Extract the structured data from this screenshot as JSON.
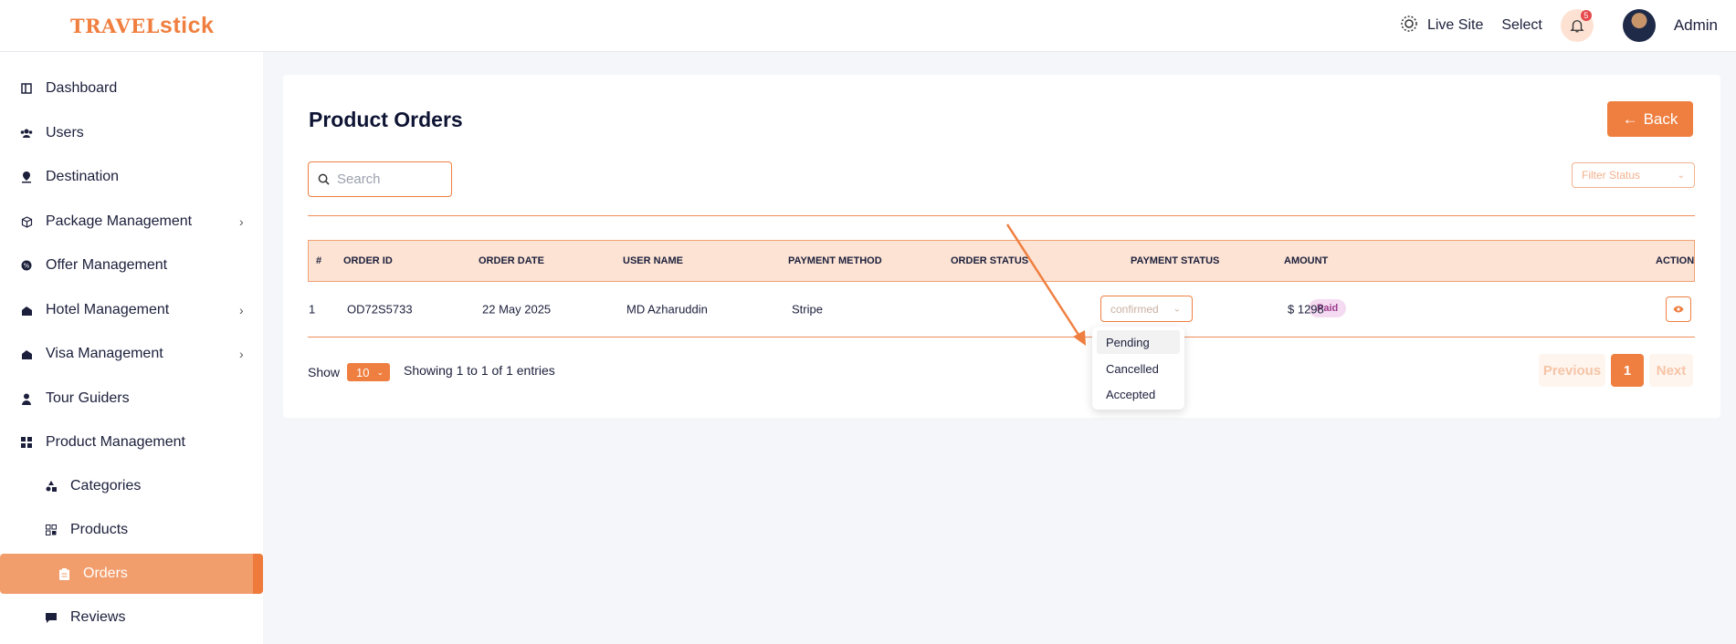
{
  "header": {
    "logo_prefix": "TRAVEL",
    "logo_suffix": "stick",
    "live_site_label": "Live Site",
    "select_label": "Select",
    "notification_count": "5",
    "admin_label": "Admin"
  },
  "sidebar": {
    "items": [
      {
        "label": "Dashboard",
        "icon": "dashboard-icon"
      },
      {
        "label": "Users",
        "icon": "users-icon"
      },
      {
        "label": "Destination",
        "icon": "location-pin-icon"
      },
      {
        "label": "Package Management",
        "icon": "box-icon",
        "has_submenu": true
      },
      {
        "label": "Offer Management",
        "icon": "offer-icon"
      },
      {
        "label": "Hotel Management",
        "icon": "hotel-icon",
        "has_submenu": true
      },
      {
        "label": "Visa Management",
        "icon": "visa-icon",
        "has_submenu": true
      },
      {
        "label": "Tour Guiders",
        "icon": "guide-icon"
      },
      {
        "label": "Product Management",
        "icon": "grid-icon"
      },
      {
        "label": "Categories",
        "icon": "shapes-icon"
      },
      {
        "label": "Products",
        "icon": "products-icon"
      },
      {
        "label": "Orders",
        "icon": "clipboard-icon",
        "active": true
      },
      {
        "label": "Reviews",
        "icon": "comment-icon"
      }
    ]
  },
  "main": {
    "title": "Product Orders",
    "back_label": "Back",
    "search_placeholder": "Search",
    "filter_placeholder": "Filter Status",
    "table": {
      "columns": [
        "#",
        "ORDER ID",
        "ORDER DATE",
        "USER NAME",
        "PAYMENT METHOD",
        "ORDER STATUS",
        "PAYMENT STATUS",
        "AMOUNT",
        "ACTION"
      ],
      "rows": [
        {
          "num": "1",
          "order_id": "OD72S5733",
          "date": "22 May 2025",
          "user": "MD Azharuddin",
          "method": "Stripe",
          "status": "confirmed",
          "payment": "Paid",
          "amount": "$ 1298"
        }
      ]
    },
    "status_options": [
      "Pending",
      "Cancelled",
      "Accepted"
    ],
    "show_label": "Show",
    "per_page": "10",
    "info": "Showing 1 to 1 of 1 entries",
    "pager": {
      "prev": "Previous",
      "current": "1",
      "next": "Next"
    }
  },
  "colors": {
    "accent": "#ef7f40",
    "header_bg": "#fde3d4",
    "active_nav": "#f29d6c"
  }
}
